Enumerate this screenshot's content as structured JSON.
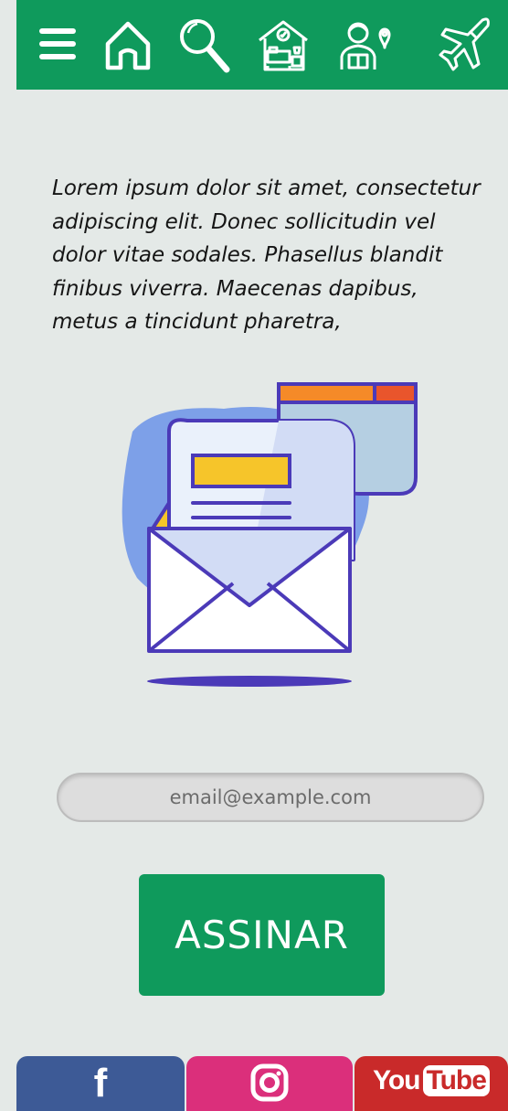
{
  "nav": {
    "items": [
      {
        "icon": "menu-icon"
      },
      {
        "icon": "home-icon"
      },
      {
        "icon": "search-icon"
      },
      {
        "icon": "hotel-room-icon"
      },
      {
        "icon": "tour-guide-icon"
      },
      {
        "icon": "airplane-icon"
      }
    ]
  },
  "intro": {
    "text": "Lorem ipsum dolor sit amet, consectetur adipiscing elit. Donec sollicitudin vel dolor vitae sodales. Phasellus blandit finibus viverra. Maecenas dapibus, metus a tincidunt pharetra,"
  },
  "newsletter": {
    "email_placeholder": "email@example.com",
    "email_value": "",
    "subscribe_label": "ASSINAR"
  },
  "footer": {
    "facebook_glyph": "f",
    "youtube_you": "You",
    "youtube_tube": "Tube"
  },
  "colors": {
    "brand_green": "#0f9a5c",
    "background": "#e4e9e7",
    "facebook": "#3d5a96",
    "instagram": "#db2f7b",
    "youtube": "#c92a2a"
  }
}
